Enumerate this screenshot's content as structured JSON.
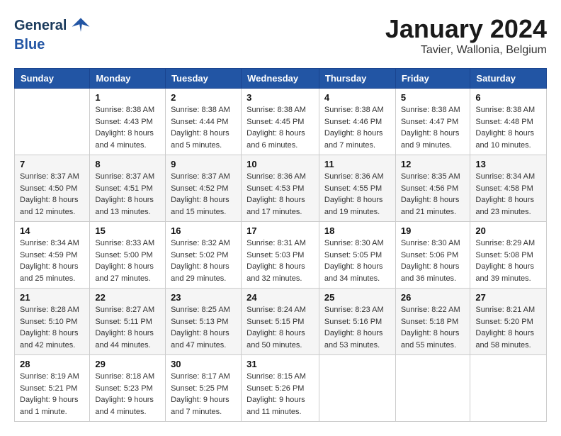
{
  "header": {
    "logo_general": "General",
    "logo_blue": "Blue",
    "month": "January 2024",
    "location": "Tavier, Wallonia, Belgium"
  },
  "weekdays": [
    "Sunday",
    "Monday",
    "Tuesday",
    "Wednesday",
    "Thursday",
    "Friday",
    "Saturday"
  ],
  "weeks": [
    [
      {
        "day": "",
        "sunrise": "",
        "sunset": "",
        "daylight": ""
      },
      {
        "day": "1",
        "sunrise": "Sunrise: 8:38 AM",
        "sunset": "Sunset: 4:43 PM",
        "daylight": "Daylight: 8 hours and 4 minutes."
      },
      {
        "day": "2",
        "sunrise": "Sunrise: 8:38 AM",
        "sunset": "Sunset: 4:44 PM",
        "daylight": "Daylight: 8 hours and 5 minutes."
      },
      {
        "day": "3",
        "sunrise": "Sunrise: 8:38 AM",
        "sunset": "Sunset: 4:45 PM",
        "daylight": "Daylight: 8 hours and 6 minutes."
      },
      {
        "day": "4",
        "sunrise": "Sunrise: 8:38 AM",
        "sunset": "Sunset: 4:46 PM",
        "daylight": "Daylight: 8 hours and 7 minutes."
      },
      {
        "day": "5",
        "sunrise": "Sunrise: 8:38 AM",
        "sunset": "Sunset: 4:47 PM",
        "daylight": "Daylight: 8 hours and 9 minutes."
      },
      {
        "day": "6",
        "sunrise": "Sunrise: 8:38 AM",
        "sunset": "Sunset: 4:48 PM",
        "daylight": "Daylight: 8 hours and 10 minutes."
      }
    ],
    [
      {
        "day": "7",
        "sunrise": "Sunrise: 8:37 AM",
        "sunset": "Sunset: 4:50 PM",
        "daylight": "Daylight: 8 hours and 12 minutes."
      },
      {
        "day": "8",
        "sunrise": "Sunrise: 8:37 AM",
        "sunset": "Sunset: 4:51 PM",
        "daylight": "Daylight: 8 hours and 13 minutes."
      },
      {
        "day": "9",
        "sunrise": "Sunrise: 8:37 AM",
        "sunset": "Sunset: 4:52 PM",
        "daylight": "Daylight: 8 hours and 15 minutes."
      },
      {
        "day": "10",
        "sunrise": "Sunrise: 8:36 AM",
        "sunset": "Sunset: 4:53 PM",
        "daylight": "Daylight: 8 hours and 17 minutes."
      },
      {
        "day": "11",
        "sunrise": "Sunrise: 8:36 AM",
        "sunset": "Sunset: 4:55 PM",
        "daylight": "Daylight: 8 hours and 19 minutes."
      },
      {
        "day": "12",
        "sunrise": "Sunrise: 8:35 AM",
        "sunset": "Sunset: 4:56 PM",
        "daylight": "Daylight: 8 hours and 21 minutes."
      },
      {
        "day": "13",
        "sunrise": "Sunrise: 8:34 AM",
        "sunset": "Sunset: 4:58 PM",
        "daylight": "Daylight: 8 hours and 23 minutes."
      }
    ],
    [
      {
        "day": "14",
        "sunrise": "Sunrise: 8:34 AM",
        "sunset": "Sunset: 4:59 PM",
        "daylight": "Daylight: 8 hours and 25 minutes."
      },
      {
        "day": "15",
        "sunrise": "Sunrise: 8:33 AM",
        "sunset": "Sunset: 5:00 PM",
        "daylight": "Daylight: 8 hours and 27 minutes."
      },
      {
        "day": "16",
        "sunrise": "Sunrise: 8:32 AM",
        "sunset": "Sunset: 5:02 PM",
        "daylight": "Daylight: 8 hours and 29 minutes."
      },
      {
        "day": "17",
        "sunrise": "Sunrise: 8:31 AM",
        "sunset": "Sunset: 5:03 PM",
        "daylight": "Daylight: 8 hours and 32 minutes."
      },
      {
        "day": "18",
        "sunrise": "Sunrise: 8:30 AM",
        "sunset": "Sunset: 5:05 PM",
        "daylight": "Daylight: 8 hours and 34 minutes."
      },
      {
        "day": "19",
        "sunrise": "Sunrise: 8:30 AM",
        "sunset": "Sunset: 5:06 PM",
        "daylight": "Daylight: 8 hours and 36 minutes."
      },
      {
        "day": "20",
        "sunrise": "Sunrise: 8:29 AM",
        "sunset": "Sunset: 5:08 PM",
        "daylight": "Daylight: 8 hours and 39 minutes."
      }
    ],
    [
      {
        "day": "21",
        "sunrise": "Sunrise: 8:28 AM",
        "sunset": "Sunset: 5:10 PM",
        "daylight": "Daylight: 8 hours and 42 minutes."
      },
      {
        "day": "22",
        "sunrise": "Sunrise: 8:27 AM",
        "sunset": "Sunset: 5:11 PM",
        "daylight": "Daylight: 8 hours and 44 minutes."
      },
      {
        "day": "23",
        "sunrise": "Sunrise: 8:25 AM",
        "sunset": "Sunset: 5:13 PM",
        "daylight": "Daylight: 8 hours and 47 minutes."
      },
      {
        "day": "24",
        "sunrise": "Sunrise: 8:24 AM",
        "sunset": "Sunset: 5:15 PM",
        "daylight": "Daylight: 8 hours and 50 minutes."
      },
      {
        "day": "25",
        "sunrise": "Sunrise: 8:23 AM",
        "sunset": "Sunset: 5:16 PM",
        "daylight": "Daylight: 8 hours and 53 minutes."
      },
      {
        "day": "26",
        "sunrise": "Sunrise: 8:22 AM",
        "sunset": "Sunset: 5:18 PM",
        "daylight": "Daylight: 8 hours and 55 minutes."
      },
      {
        "day": "27",
        "sunrise": "Sunrise: 8:21 AM",
        "sunset": "Sunset: 5:20 PM",
        "daylight": "Daylight: 8 hours and 58 minutes."
      }
    ],
    [
      {
        "day": "28",
        "sunrise": "Sunrise: 8:19 AM",
        "sunset": "Sunset: 5:21 PM",
        "daylight": "Daylight: 9 hours and 1 minute."
      },
      {
        "day": "29",
        "sunrise": "Sunrise: 8:18 AM",
        "sunset": "Sunset: 5:23 PM",
        "daylight": "Daylight: 9 hours and 4 minutes."
      },
      {
        "day": "30",
        "sunrise": "Sunrise: 8:17 AM",
        "sunset": "Sunset: 5:25 PM",
        "daylight": "Daylight: 9 hours and 7 minutes."
      },
      {
        "day": "31",
        "sunrise": "Sunrise: 8:15 AM",
        "sunset": "Sunset: 5:26 PM",
        "daylight": "Daylight: 9 hours and 11 minutes."
      },
      {
        "day": "",
        "sunrise": "",
        "sunset": "",
        "daylight": ""
      },
      {
        "day": "",
        "sunrise": "",
        "sunset": "",
        "daylight": ""
      },
      {
        "day": "",
        "sunrise": "",
        "sunset": "",
        "daylight": ""
      }
    ]
  ]
}
